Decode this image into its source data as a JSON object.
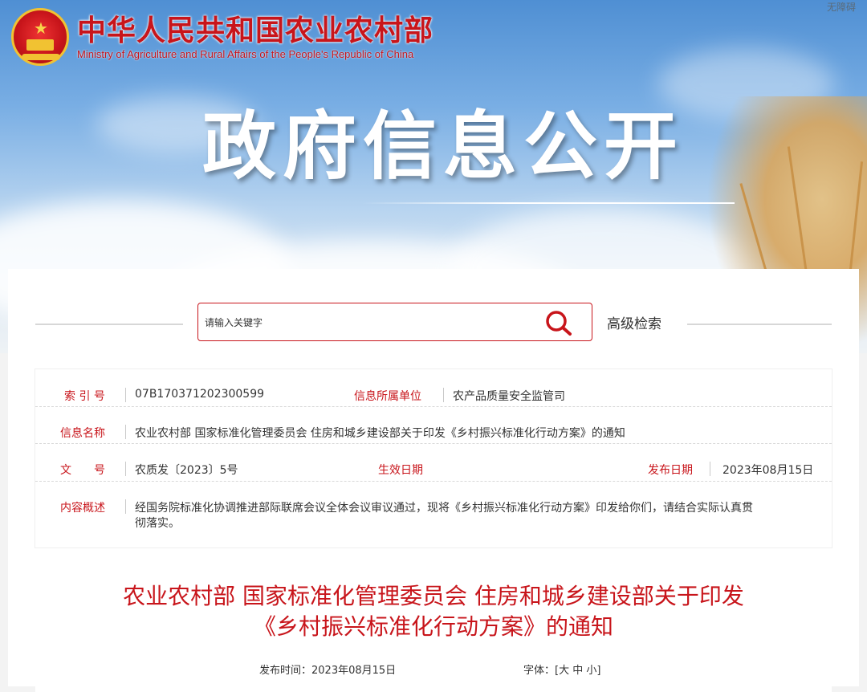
{
  "header": {
    "accessibility": "无障碍",
    "ministry_cn": "中华人民共和国农业农村部",
    "ministry_en": "Ministry of Agriculture and Rural Affairs of the People's Republic of China",
    "section_title": "政府信息公开"
  },
  "search": {
    "placeholder": "请输入关键字",
    "advanced_label": "高级检索"
  },
  "info": {
    "index_label": "索 引 号",
    "index_value": "07B170371202300599",
    "unit_label": "信息所属单位",
    "unit_value": "农产品质量安全监管司",
    "name_label": "信息名称",
    "name_value": "农业农村部 国家标准化管理委员会 住房和城乡建设部关于印发《乡村振兴标准化行动方案》的通知",
    "doc_label": "文　　号",
    "doc_value": "农质发〔2023〕5号",
    "effective_label": "生效日期",
    "effective_value": "",
    "publish_label": "发布日期",
    "publish_value": "2023年08月15日",
    "summary_label": "内容概述",
    "summary_line1": "经国务院标准化协调推进部际联席会议全体会议审议通过，现将《乡村振兴标准化行动方案》印发给你们，请结合实际认真贯",
    "summary_line2": "彻落实。"
  },
  "article": {
    "title_line1": "农业农村部 国家标准化管理委员会 住房和城乡建设部关于印发",
    "title_line2": "《乡村振兴标准化行动方案》的通知",
    "publish_time_label": "发布时间：",
    "publish_time_value": "2023年08月15日",
    "font_label": "字体：",
    "font_open": "[",
    "font_large": "大",
    "font_medium": "中",
    "font_small": "小",
    "font_close": "]"
  },
  "colors": {
    "accent": "#c8151b",
    "text": "#333333",
    "page_bg": "#f3f3f3"
  }
}
